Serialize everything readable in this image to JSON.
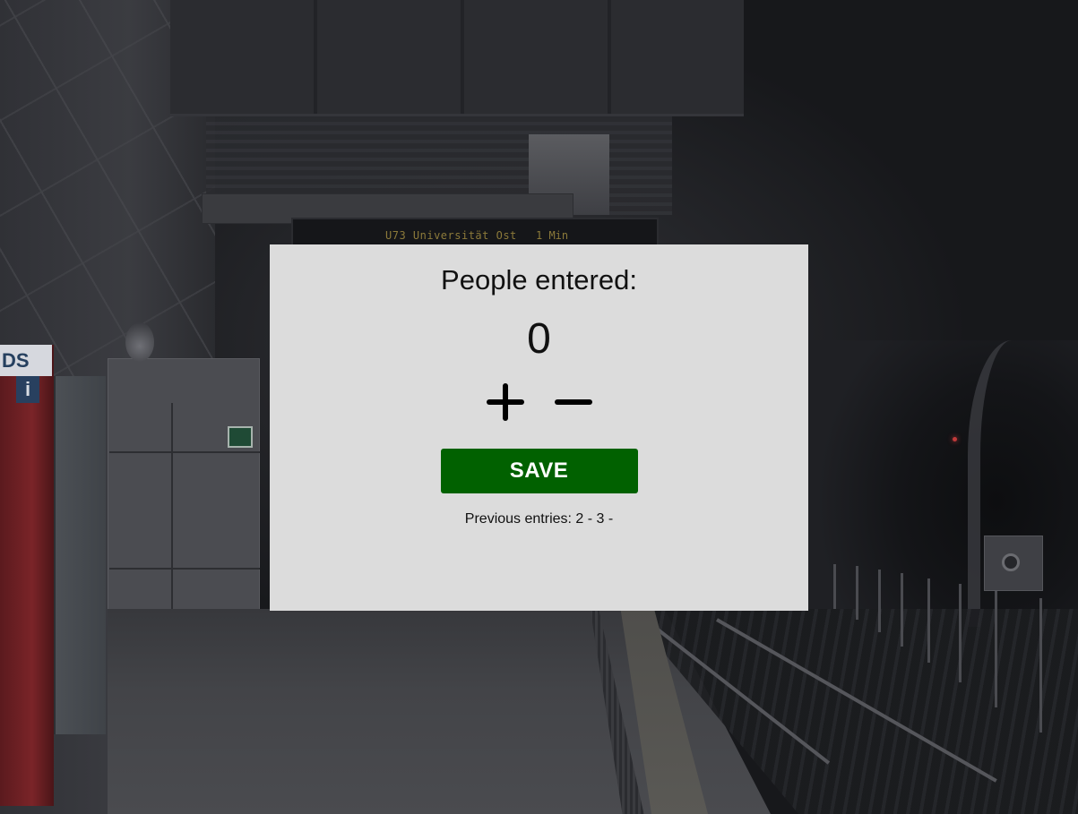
{
  "background": {
    "sign_line": "U73  Universität Ost",
    "sign_time": "1 Min",
    "column_sign": "DS",
    "info_glyph": "i"
  },
  "dialog": {
    "title": "People entered:",
    "count": "0",
    "increment_icon": "plus-icon",
    "decrement_icon": "minus-icon",
    "save_label": "SAVE",
    "previous_entries_text": "Previous entries: 2 - 3 -",
    "colors": {
      "dialog_background": "#dcdcdc",
      "save_button": "#016100",
      "save_text": "#ffffff"
    }
  }
}
